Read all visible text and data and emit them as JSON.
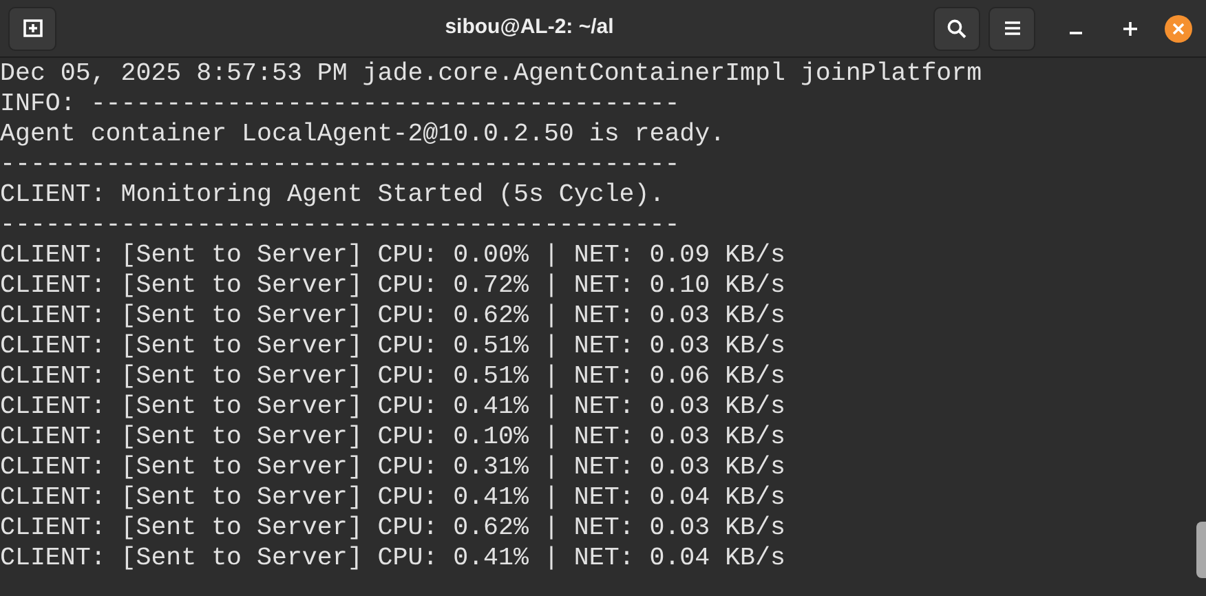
{
  "window": {
    "title": "sibou@AL-2: ~/al"
  },
  "terminal": {
    "lines": [
      "Dec 05, 2025 8:57:53 PM jade.core.AgentContainerImpl joinPlatform",
      "INFO: ---------------------------------------",
      "Agent container LocalAgent-2@10.0.2.50 is ready.",
      "---------------------------------------------",
      "CLIENT: Monitoring Agent Started (5s Cycle).",
      "---------------------------------------------",
      "CLIENT: [Sent to Server] CPU: 0.00% | NET: 0.09 KB/s",
      "CLIENT: [Sent to Server] CPU: 0.72% | NET: 0.10 KB/s",
      "CLIENT: [Sent to Server] CPU: 0.62% | NET: 0.03 KB/s",
      "CLIENT: [Sent to Server] CPU: 0.51% | NET: 0.03 KB/s",
      "CLIENT: [Sent to Server] CPU: 0.51% | NET: 0.06 KB/s",
      "CLIENT: [Sent to Server] CPU: 0.41% | NET: 0.03 KB/s",
      "CLIENT: [Sent to Server] CPU: 0.10% | NET: 0.03 KB/s",
      "CLIENT: [Sent to Server] CPU: 0.31% | NET: 0.03 KB/s",
      "CLIENT: [Sent to Server] CPU: 0.41% | NET: 0.04 KB/s",
      "CLIENT: [Sent to Server] CPU: 0.62% | NET: 0.03 KB/s",
      "CLIENT: [Sent to Server] CPU: 0.41% | NET: 0.04 KB/s"
    ]
  }
}
